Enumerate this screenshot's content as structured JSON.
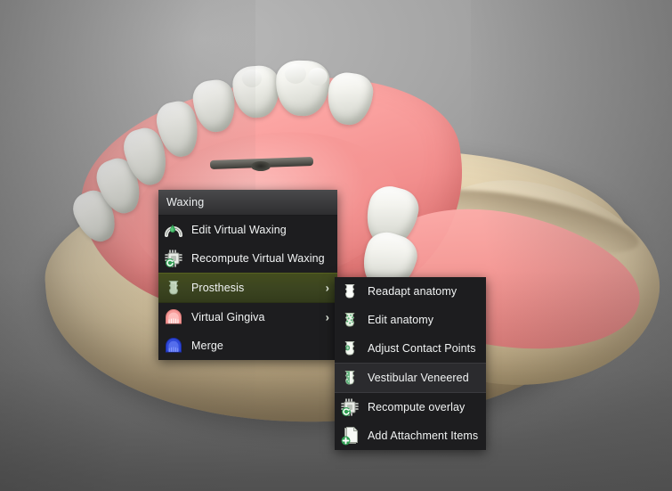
{
  "app": {
    "viewport_name": "dental-3d-model-viewport"
  },
  "main_menu": {
    "title": "Waxing",
    "items": [
      {
        "label": "Edit Virtual Waxing",
        "icon": "waxing-arch-drop-icon",
        "has_submenu": false,
        "state": "normal"
      },
      {
        "label": "Recompute Virtual Waxing",
        "icon": "cpu-chip-refresh-icon",
        "has_submenu": false,
        "state": "normal"
      },
      {
        "label": "Prosthesis",
        "icon": "tooth-green-icon",
        "has_submenu": true,
        "state": "highlighted"
      },
      {
        "label": "Virtual Gingiva",
        "icon": "pink-gingiva-arch-icon",
        "has_submenu": true,
        "state": "normal"
      },
      {
        "label": "Merge",
        "icon": "blue-arch-merge-icon",
        "has_submenu": false,
        "state": "normal"
      }
    ],
    "submenu_arrow": "›"
  },
  "sub_menu": {
    "items": [
      {
        "label": "Readapt anatomy",
        "icon": "tooth-white-icon",
        "state": "normal"
      },
      {
        "label": "Edit anatomy",
        "icon": "tooth-speckled-icon",
        "state": "normal"
      },
      {
        "label": "Adjust Contact Points",
        "icon": "tooth-contact-point-icon",
        "state": "normal"
      },
      {
        "label": "Vestibular Veneered",
        "icon": "tooth-veneer-icon",
        "state": "soft-highlighted"
      },
      {
        "label": "Recompute overlay",
        "icon": "cpu-chip-refresh-icon",
        "state": "normal"
      },
      {
        "label": "Add Attachment Items",
        "icon": "document-add-icon",
        "state": "normal"
      }
    ]
  },
  "colors": {
    "menu_background": "#1d1d1f",
    "menu_header_background": "#3a3a3c",
    "menu_text": "#f2f4f4",
    "highlight_olive": "#3b4420",
    "soft_highlight": "#2b2b2e",
    "accent_green": "#2f9e52",
    "gingiva_pink": "#f59795",
    "merge_blue": "#2f49d8",
    "stone_beige": "#e3d2ae",
    "viewport_gray": "#8c8c8c"
  }
}
